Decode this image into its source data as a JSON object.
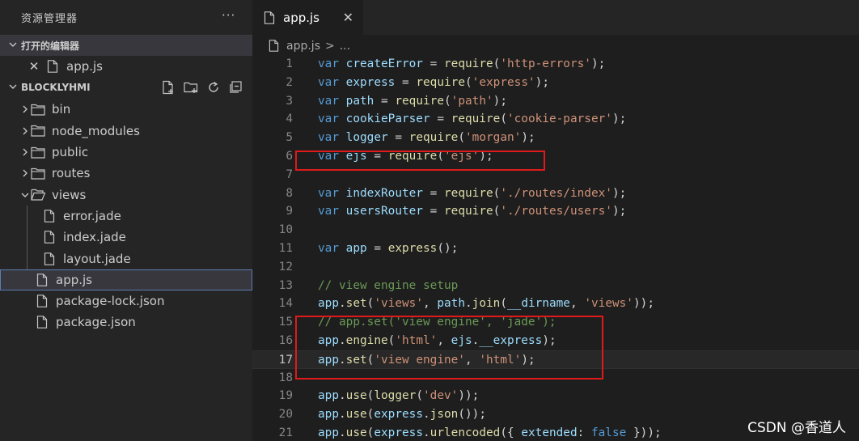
{
  "sidebar": {
    "title": "资源管理器",
    "more": "···",
    "open_editors": {
      "label": "打开的编辑器",
      "items": [
        {
          "label": "app.js"
        }
      ]
    },
    "project": {
      "label": "BLOCKLYHMI",
      "tree": [
        {
          "label": "bin",
          "type": "folder",
          "open": false
        },
        {
          "label": "node_modules",
          "type": "folder",
          "open": false
        },
        {
          "label": "public",
          "type": "folder",
          "open": false
        },
        {
          "label": "routes",
          "type": "folder",
          "open": false
        },
        {
          "label": "views",
          "type": "folder",
          "open": true
        },
        {
          "label": "error.jade",
          "type": "file"
        },
        {
          "label": "index.jade",
          "type": "file"
        },
        {
          "label": "layout.jade",
          "type": "file"
        },
        {
          "label": "app.js",
          "type": "file",
          "selected": true
        },
        {
          "label": "package-lock.json",
          "type": "file"
        },
        {
          "label": "package.json",
          "type": "file"
        }
      ]
    }
  },
  "editor": {
    "tab_label": "app.js",
    "breadcrumb": {
      "file": "app.js",
      "sep": ">",
      "rest": "..."
    },
    "lines": [
      {
        "n": "1",
        "text": "var createError = require('http-errors');"
      },
      {
        "n": "2",
        "text": "var express = require('express');"
      },
      {
        "n": "3",
        "text": "var path = require('path');"
      },
      {
        "n": "4",
        "text": "var cookieParser = require('cookie-parser');"
      },
      {
        "n": "5",
        "text": "var logger = require('morgan');"
      },
      {
        "n": "6",
        "text": "var ejs = require('ejs');"
      },
      {
        "n": "7",
        "text": ""
      },
      {
        "n": "8",
        "text": "var indexRouter = require('./routes/index');"
      },
      {
        "n": "9",
        "text": "var usersRouter = require('./routes/users');"
      },
      {
        "n": "10",
        "text": ""
      },
      {
        "n": "11",
        "text": "var app = express();"
      },
      {
        "n": "12",
        "text": ""
      },
      {
        "n": "13",
        "text": "// view engine setup"
      },
      {
        "n": "14",
        "text": "app.set('views', path.join(__dirname, 'views'));"
      },
      {
        "n": "15",
        "text": "// app.set('view engine', 'jade');"
      },
      {
        "n": "16",
        "text": "app.engine('html', ejs.__express);"
      },
      {
        "n": "17",
        "text": "app.set('view engine', 'html');"
      },
      {
        "n": "18",
        "text": ""
      },
      {
        "n": "19",
        "text": "app.use(logger('dev'));"
      },
      {
        "n": "20",
        "text": "app.use(express.json());"
      },
      {
        "n": "21",
        "text": "app.use(express.urlencoded({ extended: false }));"
      }
    ],
    "current_line": "17"
  },
  "watermark": "CSDN @香道人",
  "colors": {
    "highlight_box": "#e01a1a",
    "keyword": "#569cd6",
    "string": "#ce9178",
    "comment": "#6a9955"
  }
}
